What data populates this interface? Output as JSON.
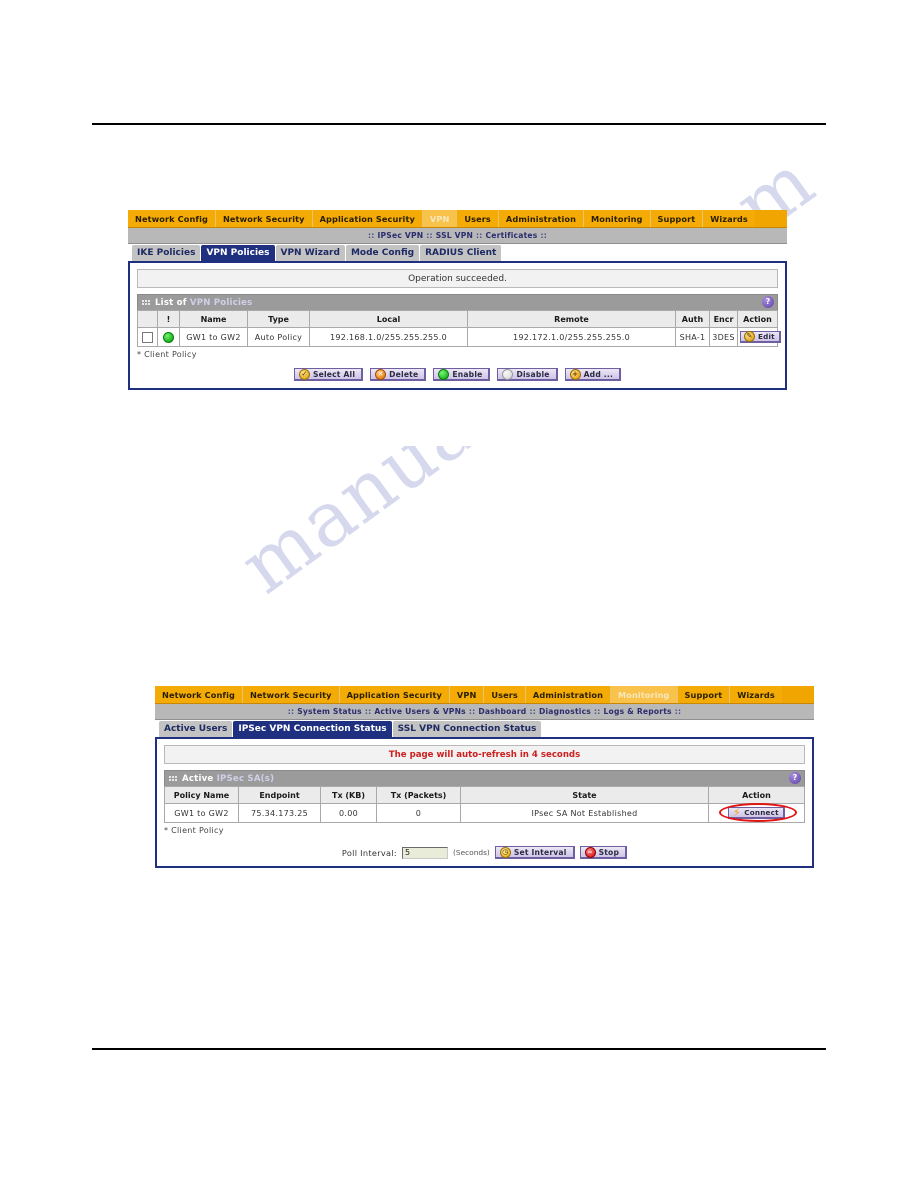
{
  "watermark": {
    "text": "manualshive.com"
  },
  "figure1": {
    "topnav": [
      {
        "label": "Network Config",
        "active": false
      },
      {
        "label": "Network Security",
        "active": false
      },
      {
        "label": "Application Security",
        "active": false
      },
      {
        "label": "VPN",
        "active": true
      },
      {
        "label": "Users",
        "active": false
      },
      {
        "label": "Administration",
        "active": false
      },
      {
        "label": "Monitoring",
        "active": false
      },
      {
        "label": "Support",
        "active": false
      },
      {
        "label": "Wizards",
        "active": false
      }
    ],
    "subnav": [
      "IPSec VPN",
      "SSL VPN",
      "Certificates"
    ],
    "tabs": [
      {
        "label": "IKE Policies",
        "active": false
      },
      {
        "label": "VPN Policies",
        "active": true
      },
      {
        "label": "VPN Wizard",
        "active": false
      },
      {
        "label": "Mode Config",
        "active": false
      },
      {
        "label": "RADIUS Client",
        "active": false
      }
    ],
    "message": "Operation succeeded.",
    "section": {
      "title_prefix": "List of ",
      "title_accent": "VPN Policies",
      "help_label": "?"
    },
    "table": {
      "headers": [
        "",
        "!",
        "Name",
        "Type",
        "Local",
        "Remote",
        "Auth",
        "Encr",
        "Action"
      ],
      "rows": [
        {
          "name": "GW1 to GW2",
          "type": "Auto Policy",
          "local": "192.168.1.0/255.255.255.0",
          "remote": "192.172.1.0/255.255.255.0",
          "auth": "SHA-1",
          "encr": "3DES",
          "action": "Edit"
        }
      ]
    },
    "footnote": "* Client Policy",
    "buttons": [
      {
        "label": "Select All",
        "icon": "check-circle-icon"
      },
      {
        "label": "Delete",
        "icon": "x-circle-icon"
      },
      {
        "label": "Enable",
        "icon": "green-circle-icon"
      },
      {
        "label": "Disable",
        "icon": "gray-circle-icon"
      },
      {
        "label": "Add ...",
        "icon": "plus-circle-icon"
      }
    ]
  },
  "figure2": {
    "topnav": [
      {
        "label": "Network Config",
        "active": false
      },
      {
        "label": "Network Security",
        "active": false
      },
      {
        "label": "Application Security",
        "active": false
      },
      {
        "label": "VPN",
        "active": false
      },
      {
        "label": "Users",
        "active": false
      },
      {
        "label": "Administration",
        "active": false
      },
      {
        "label": "Monitoring",
        "active": true
      },
      {
        "label": "Support",
        "active": false
      },
      {
        "label": "Wizards",
        "active": false
      }
    ],
    "subnav": [
      "System Status",
      "Active Users & VPNs",
      "Dashboard",
      "Diagnostics",
      "Logs & Reports"
    ],
    "tabs": [
      {
        "label": "Active Users",
        "active": false
      },
      {
        "label": "IPSec VPN Connection Status",
        "active": true
      },
      {
        "label": "SSL VPN Connection Status",
        "active": false
      }
    ],
    "message": "The page will auto-refresh in 4 seconds",
    "section": {
      "title_prefix": "Active ",
      "title_accent": "IPSec SA(s)",
      "help_label": "?"
    },
    "table": {
      "headers": [
        "Policy Name",
        "Endpoint",
        "Tx (KB)",
        "Tx (Packets)",
        "State",
        "Action"
      ],
      "rows": [
        {
          "policy_name": "GW1 to GW2",
          "endpoint": "75.34.173.25",
          "tx_kb": "0.00",
          "tx_packets": "0",
          "state": "IPsec SA Not Established",
          "action": "Connect"
        }
      ]
    },
    "footnote": "* Client Policy",
    "poll": {
      "label": "Poll Interval:",
      "value": "5",
      "unit": "(Seconds)",
      "set_label": "Set Interval",
      "stop_label": "Stop"
    }
  }
}
